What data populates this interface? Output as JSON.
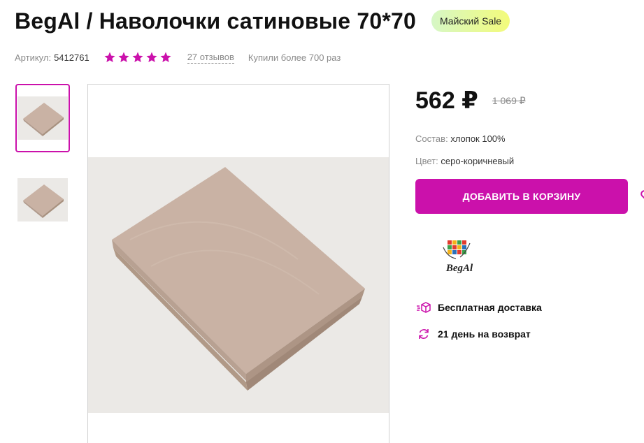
{
  "product": {
    "title": "BegAl / Наволочки сатиновые 70*70",
    "badge": "Майский Sale",
    "article_label": "Артикул:",
    "article_value": "5412761",
    "rating_stars": 5,
    "reviews": "27 отзывов",
    "bought": "Купили более 700 раз"
  },
  "price": {
    "current": "562 ₽",
    "old": "1 069 ₽"
  },
  "specs": [
    {
      "label": "Состав:",
      "value": "хлопок 100%"
    },
    {
      "label": "Цвет:",
      "value": "серо-коричневый"
    }
  ],
  "cart": {
    "label": "Добавить в корзину"
  },
  "brand": {
    "logo_text": "BegAl"
  },
  "features": [
    {
      "icon": "box-delivery-icon",
      "label": "Бесплатная доставка"
    },
    {
      "icon": "refresh-icon",
      "label": "21 день на возврат"
    }
  ],
  "colors": {
    "accent": "#cb11ab",
    "badge_from": "#d6f7c6",
    "badge_to": "#f3fb7a",
    "product": "#c9b2a4"
  }
}
